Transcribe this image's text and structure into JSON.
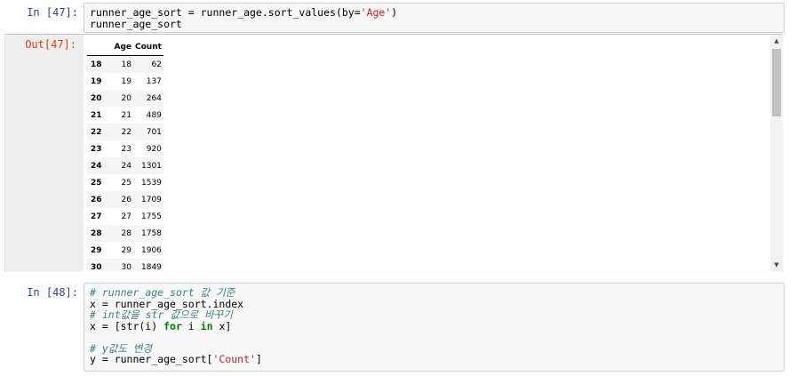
{
  "cell47": {
    "in_prompt": "In [47]:",
    "out_prompt": "Out[47]:",
    "code": {
      "line1_a": "runner_age_sort = runner_age.sort_values(by=",
      "line1_str": "'Age'",
      "line1_b": ")",
      "line2": "runner_age_sort"
    },
    "table": {
      "columns": [
        "",
        "Age",
        "Count"
      ],
      "rows": [
        {
          "index": "18",
          "age": "18",
          "count": "62"
        },
        {
          "index": "19",
          "age": "19",
          "count": "137"
        },
        {
          "index": "20",
          "age": "20",
          "count": "264"
        },
        {
          "index": "21",
          "age": "21",
          "count": "489"
        },
        {
          "index": "22",
          "age": "22",
          "count": "701"
        },
        {
          "index": "23",
          "age": "23",
          "count": "920"
        },
        {
          "index": "24",
          "age": "24",
          "count": "1301"
        },
        {
          "index": "25",
          "age": "25",
          "count": "1539"
        },
        {
          "index": "26",
          "age": "26",
          "count": "1709"
        },
        {
          "index": "27",
          "age": "27",
          "count": "1755"
        },
        {
          "index": "28",
          "age": "28",
          "count": "1758"
        },
        {
          "index": "29",
          "age": "29",
          "count": "1906"
        },
        {
          "index": "30",
          "age": "30",
          "count": "1849"
        }
      ]
    }
  },
  "cell48": {
    "in_prompt": "In [48]:",
    "code": {
      "c1": "# runner_age_sort 값 기준",
      "l2": "x = runner_age_sort.index",
      "c3": "# int값을 str 값으로 바꾸기",
      "l4_a": "x = [str(i) ",
      "l4_for": "for",
      "l4_b": " i ",
      "l4_in": "in",
      "l4_c": " x]",
      "c6": "# y값도 변경",
      "l7_a": "y = runner_age_sort[",
      "l7_str": "'Count'",
      "l7_b": "]"
    }
  },
  "icons": {
    "scroll_up": "triangle-up",
    "scroll_down": "triangle-down"
  },
  "colors": {
    "in_prompt": "#303f9f",
    "out_prompt": "#d84315",
    "keyword": "#008000",
    "string": "#ba2121",
    "comment": "#408080"
  }
}
